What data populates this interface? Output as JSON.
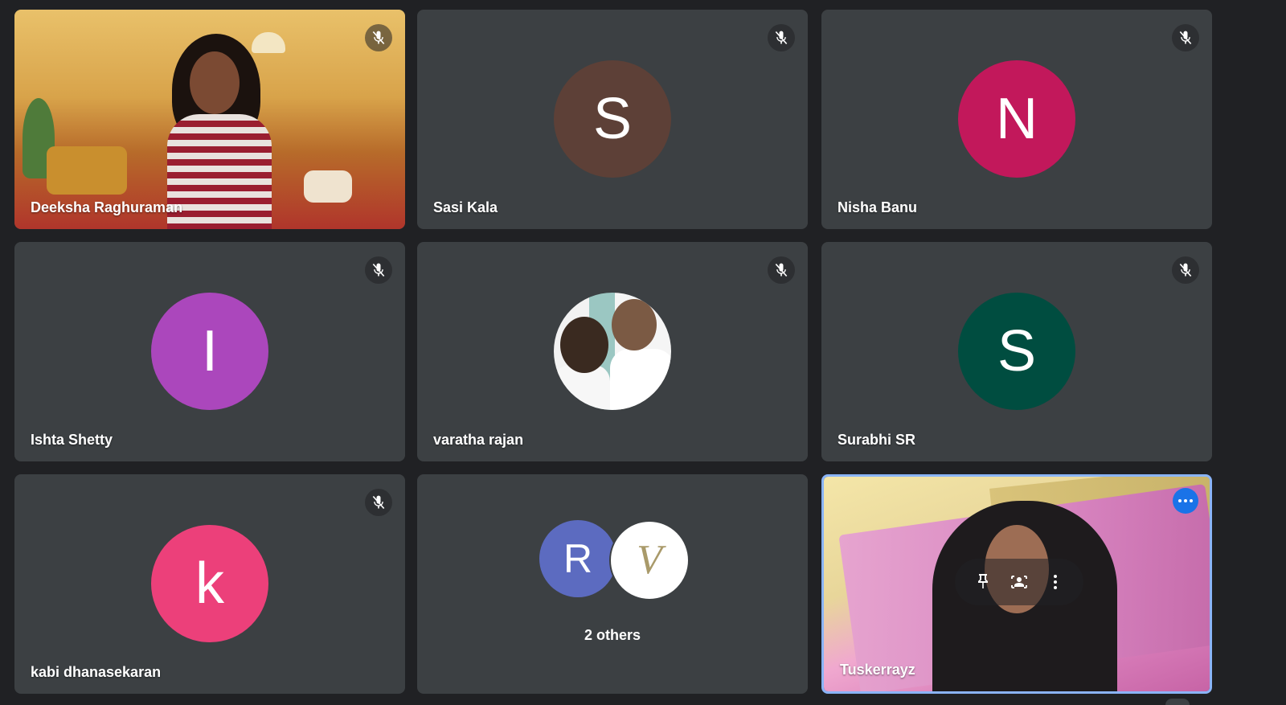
{
  "tiles": [
    {
      "name": "Deeksha Raghuraman",
      "kind": "video"
    },
    {
      "name": "Sasi Kala",
      "initial": "S",
      "color": "#5d4037"
    },
    {
      "name": "Nisha Banu",
      "initial": "N",
      "color": "#c2185b"
    },
    {
      "name": "Ishta Shetty",
      "initial": "I",
      "color": "#ab47bc"
    },
    {
      "name": "varatha rajan",
      "kind": "photo"
    },
    {
      "name": "Surabhi SR",
      "initial": "S",
      "color": "#004d40"
    },
    {
      "name": "kabi dhanasekaran",
      "initial": "k",
      "color": "#ec407a"
    },
    {
      "name": "Tuskerrayz",
      "kind": "video",
      "active": true
    }
  ],
  "others": {
    "label": "2 others",
    "avatars": [
      {
        "initial": "R",
        "color": "#5c6bc0"
      },
      {
        "initial": "V",
        "color": "#ffffff"
      }
    ]
  },
  "icons": {
    "mic_off": "mic-off-icon",
    "more": "more-options-icon",
    "pin": "pin-icon",
    "frame": "frame-person-icon",
    "kebab": "more-vert-icon"
  },
  "colors": {
    "background": "#202124",
    "tile": "#3c4043",
    "active_border": "#8ab4f8",
    "accent": "#1a73e8"
  }
}
